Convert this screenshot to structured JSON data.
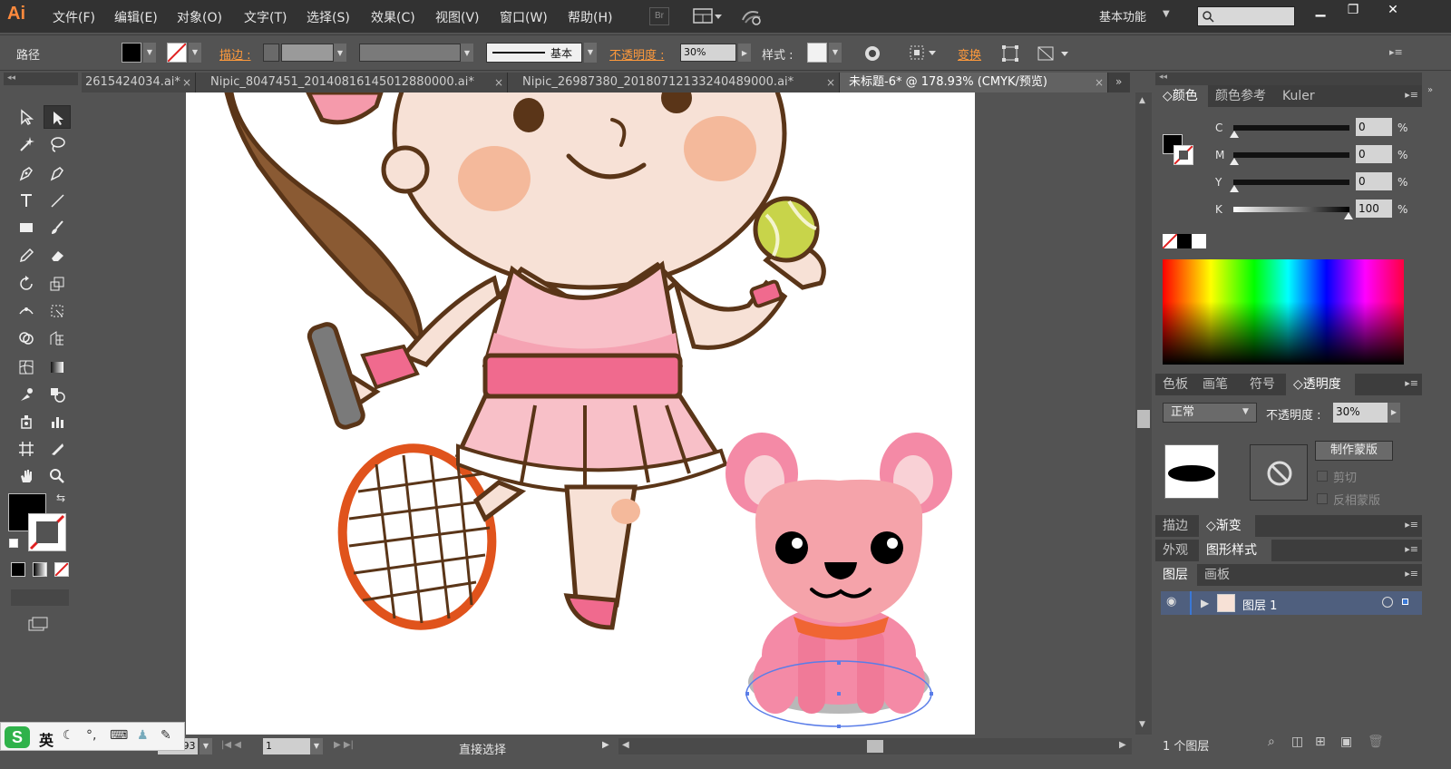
{
  "app": {
    "logo": "Ai",
    "menu": [
      "文件(F)",
      "编辑(E)",
      "对象(O)",
      "文字(T)",
      "选择(S)",
      "效果(C)",
      "视图(V)",
      "窗口(W)",
      "帮助(H)"
    ],
    "bridge_label": "Br",
    "workspace": "基本功能",
    "window_controls": [
      "▁",
      "❐",
      "✕"
    ]
  },
  "control_bar": {
    "selection_type": "路径",
    "stroke_label": "描边 :",
    "stroke_style_label": "基本",
    "opacity_label": "不透明度 :",
    "opacity_value": "30%",
    "style_label": "样式 :",
    "transform_label": "变换"
  },
  "tabs": [
    {
      "label": "2615424034.ai*",
      "active": false
    },
    {
      "label": "Nipic_8047451_20140816145012880000.ai*",
      "active": false
    },
    {
      "label": "Nipic_26987380_20180712133240489000.ai*",
      "active": false
    },
    {
      "label": "未标题-6* @ 178.93% (CMYK/预览)",
      "active": true
    }
  ],
  "status_bar": {
    "zoom": "178.93",
    "page": "1",
    "status": "直接选择"
  },
  "ime": {
    "logo": "S",
    "lang": "英"
  },
  "color_panel": {
    "tabs": [
      "颜色",
      "颜色参考",
      "Kuler"
    ],
    "channels": [
      {
        "label": "C",
        "value": "0",
        "level": 0
      },
      {
        "label": "M",
        "value": "0",
        "level": 0
      },
      {
        "label": "Y",
        "value": "0",
        "level": 0
      },
      {
        "label": "K",
        "value": "100",
        "level": 100
      }
    ],
    "pct": "%"
  },
  "transparency_panel": {
    "tabs": [
      "色板",
      "画笔",
      "符号",
      "透明度"
    ],
    "blend_mode": "正常",
    "opacity_label": "不透明度 :",
    "opacity_value": "30%",
    "make_mask": "制作蒙版",
    "clip": "剪切",
    "invert_mask": "反相蒙版"
  },
  "stroke_panel": {
    "tabs": [
      "描边",
      "渐变"
    ]
  },
  "appearance_panel": {
    "tabs": [
      "外观",
      "图形样式"
    ]
  },
  "layers_panel": {
    "tabs": [
      "图层",
      "画板"
    ],
    "layers": [
      {
        "name": "图层 1"
      }
    ],
    "footer": "1 个图层"
  },
  "colors": {
    "accent_orange": "#ff9a3c",
    "panel_bg": "#535353",
    "menubar_bg": "#323232",
    "layer_selected": "#4f5f7e"
  }
}
